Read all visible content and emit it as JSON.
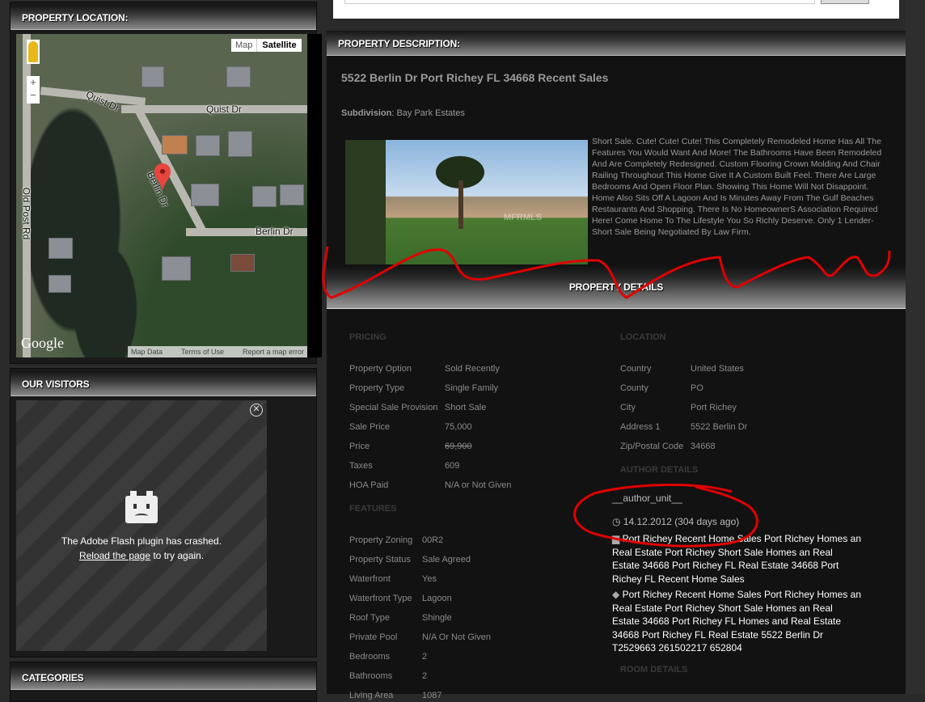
{
  "sidebar": {
    "location_title": "PROPERTY LOCATION:",
    "map": {
      "type_map": "Map",
      "type_satellite": "Satellite",
      "zoom_in": "+",
      "zoom_out": "−",
      "streets": [
        "Quist Dr",
        "Quist Dr",
        "Berlin Dr",
        "Berlin Dr",
        "Old Post Rd"
      ],
      "logo": "Google",
      "footer": [
        "Map Data",
        "Terms of Use",
        "Report a map error"
      ]
    },
    "visitors_title": "OUR VISITORS",
    "flash": {
      "message": "The Adobe Flash plugin has crashed.",
      "reload_link": "Reload the page",
      "reload_suffix": " to try again."
    },
    "categories_title": "CATEGORIES"
  },
  "description": {
    "header": "PROPERTY DESCRIPTION:",
    "title": "5522 Berlin Dr Port Richey FL 34668 Recent Sales",
    "subdivision_label": "Subdivision",
    "subdivision_value": ": Bay Park Estates",
    "text": "Short Sale. Cute! Cute! Cute! This Completely Remodeled Home Has All The Features You Would Want And More! The Bathrooms Have Been Remodeled And Are Completely Redesigned. Custom Flooring Crown Molding And Chair Railing Throughout This Home Give It A Custom Built Feel. There Are Large Bedrooms And Open Floor Plan. Showing This Home Will Not Disappoint. Home Also Sits Off A Lagoon And Is Minutes Away From The Gulf Beaches Restaurants And Shopping. There Is No HomeownerS Association Required Here! Come Home To The Lifestyle You So Richly Deserve. Only 1 Lender-Short Sale Being Negotiated By Law Firm.",
    "photo_watermark": "MFRMLS"
  },
  "details": {
    "header": "PROPERTY DETAILS",
    "pricing_title": "PRICING",
    "pricing": [
      [
        "Property Option",
        "Sold Recently"
      ],
      [
        "Property Type",
        "Single Family"
      ],
      [
        "Special Sale Provision",
        "Short Sale"
      ],
      [
        "Sale Price",
        "75,000"
      ],
      [
        "Price",
        "69,900"
      ],
      [
        "Taxes",
        "609"
      ],
      [
        "HOA Paid",
        "N/A or Not Given"
      ]
    ],
    "features_title": "FEATURES",
    "features": [
      [
        "Property Zoning",
        "00R2"
      ],
      [
        "Property Status",
        "Sale Agreed"
      ],
      [
        "Waterfront",
        "Yes"
      ],
      [
        "Waterfront Type",
        "Lagoon"
      ],
      [
        "Roof Type",
        "Shingle"
      ],
      [
        "Private Pool",
        "N/A Or Not Given"
      ],
      [
        "Bedrooms",
        "2"
      ],
      [
        "Bathrooms",
        "2"
      ],
      [
        "Living Area",
        "1087"
      ]
    ],
    "location_title": "LOCATION",
    "location": [
      [
        "Country",
        "United States"
      ],
      [
        "County",
        "PO"
      ],
      [
        "City",
        "Port Richey"
      ],
      [
        "Address 1",
        "5522 Berlin Dr"
      ],
      [
        "Zip/Postal Code",
        "34668"
      ]
    ],
    "author_title": "AUTHOR DETAILS",
    "author": "__author_unit__",
    "date": "14.12.2012 (304 days ago)",
    "categories": "Port Richey Recent Home Sales Port Richey Homes an Real Estate Port Richey Short Sale Homes an Real Estate 34668 Port Richey FL Real Estate 34668 Port Richey FL Recent Home Sales",
    "tags": "Port Richey Recent Home Sales Port Richey Homes an Real Estate Port Richey Short Sale Homes an Real Estate 34668 Port Richey FL Homes and Real Estate 34668 Port Richey FL Real Estate 5522 Berlin Dr T2529663 261502217 652804",
    "room_title": "ROOM DETAILS"
  },
  "colors": {
    "annotation": "#e00000",
    "panel": "#1a1a1a",
    "main": "#121212"
  }
}
